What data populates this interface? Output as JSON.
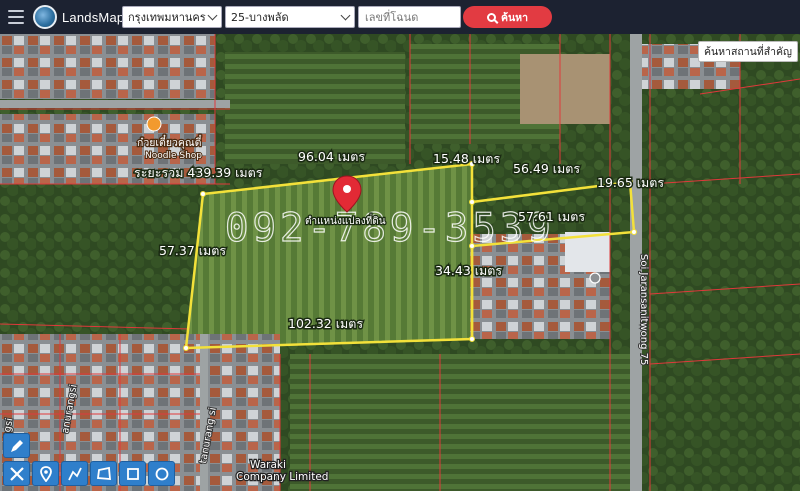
{
  "header": {
    "brand": "LandsMaps",
    "province_select": "กรุงเทพมหานคร",
    "district_select": "25-บางพลัด",
    "deed_placeholder": "เลขที่โฉนด",
    "search_label": "ค้นหา"
  },
  "place_search_label": "ค้นหาสถานที่สำคัญ",
  "parcel_labels": {
    "total_perimeter": "ระยะรวม 439.39 เมตร",
    "top_edge": "96.04 เมตร",
    "top_edge_2": "15.48 เมตร",
    "right_top_edge": "56.49 เมตร",
    "right_short_edge": "19.65 เมตร",
    "right_mid_edge": "57.61 เมตร",
    "left_edge": "57.37 เมตร",
    "inner_edge": "34.43 เมตร",
    "bottom_edge": "102.32 เมตร",
    "pin_caption": "ตำแหน่งแปลงที่ดิน"
  },
  "watermark": "092-789-3539",
  "map_labels": {
    "shop_name": "ก๋วยเตี๋ยวคุณตี๋",
    "shop_subtitle": "Noodle Shop",
    "company_line1": "Waraki",
    "company_line2": "Company Limited",
    "road_right": "Soi Jaransanitwong 75",
    "road_left_1": "anurangsi",
    "road_left_2": "ngsi",
    "road_left_3": "tanurang si"
  },
  "icons": [
    "menu-icon",
    "logo-icon",
    "search-icon",
    "chevron-down-icon",
    "location-pin-icon",
    "draw-tool-icon",
    "measure-icon",
    "marker-icon",
    "polyline-icon",
    "polygon-icon",
    "square-icon",
    "circle-icon"
  ],
  "colors": {
    "header_bg": "#1c2231",
    "search_red": "#e23b42",
    "parcel_yellow": "#f3e13a",
    "boundary_red": "#e0393b",
    "tool_blue": "#2f7fcb"
  }
}
